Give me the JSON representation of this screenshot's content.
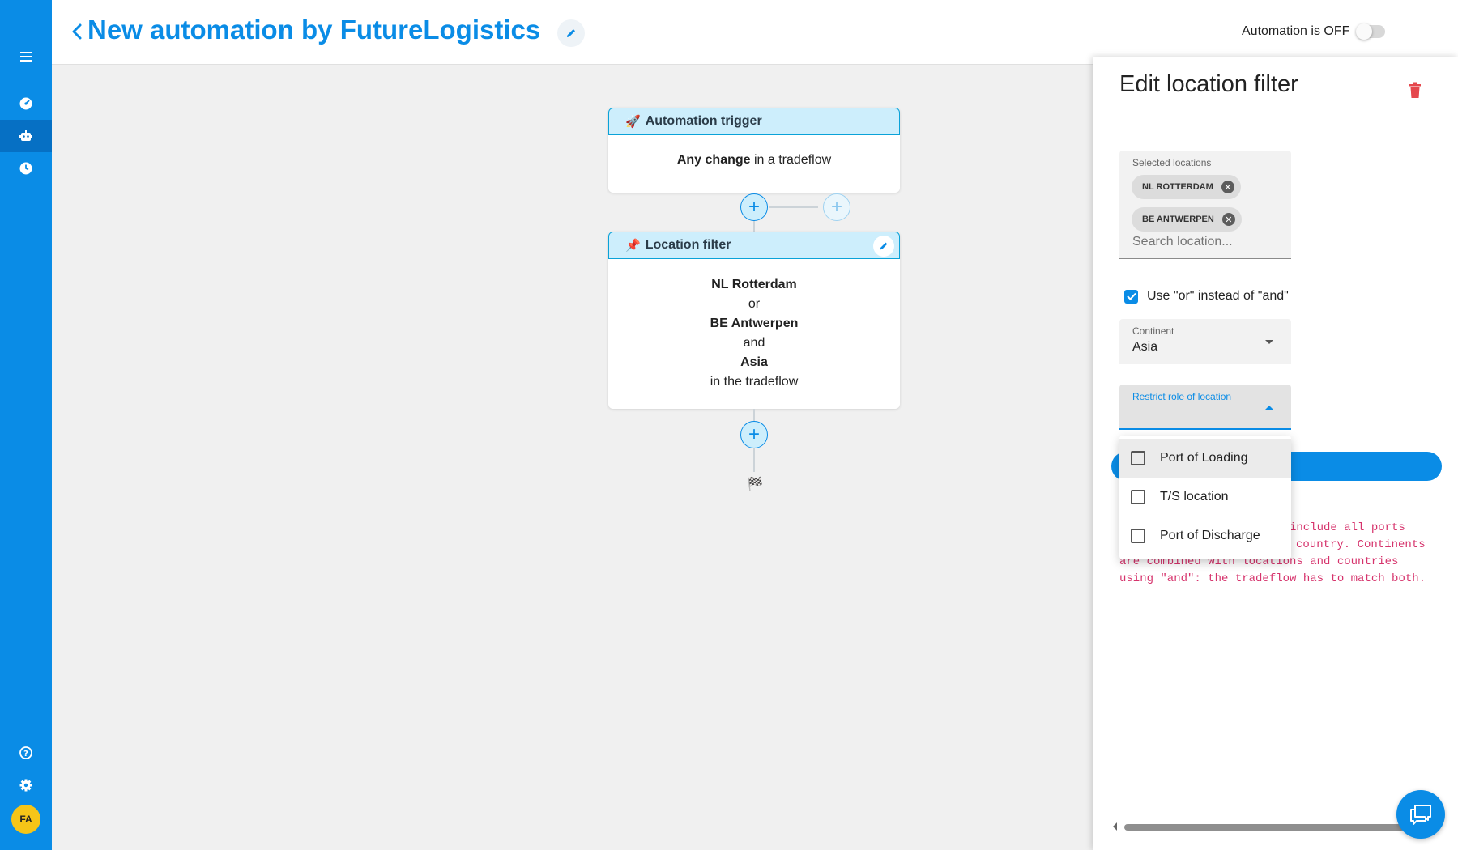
{
  "sidebar": {
    "items": [
      {
        "icon": "menu-icon"
      },
      {
        "icon": "dashboard-icon"
      },
      {
        "icon": "robot-icon",
        "active": true
      },
      {
        "icon": "clock-icon"
      },
      {
        "icon": "help-icon"
      },
      {
        "icon": "settings-icon"
      }
    ],
    "avatar_initials": "FA"
  },
  "header": {
    "title": "New automation by FutureLogistics",
    "status_text": "Automation is OFF",
    "toggle_on": false
  },
  "flow": {
    "trigger": {
      "emoji": "🚀",
      "title": "Automation trigger",
      "body_bold": "Any change",
      "body_rest": " in a tradeflow"
    },
    "filter": {
      "emoji": "📌",
      "title": "Location filter",
      "lines": [
        {
          "text": "NL Rotterdam",
          "bold": true
        },
        {
          "text": "or",
          "bold": false
        },
        {
          "text": "BE Antwerpen",
          "bold": true
        },
        {
          "text": "and",
          "bold": false
        },
        {
          "text": "Asia",
          "bold": true
        },
        {
          "text": "in the tradeflow",
          "bold": false
        }
      ]
    },
    "plus_symbol": "+",
    "end_flag": "🏁"
  },
  "panel": {
    "title": "Edit location filter",
    "selected_label": "Selected locations",
    "chips": [
      "NL ROTTERDAM",
      "BE ANTWERPEN"
    ],
    "chip_remove": "✕",
    "search_placeholder": "Search location...",
    "checkbox_label": "Use \"or\" instead of \"and\"",
    "checkbox_checked": true,
    "continent_label": "Continent",
    "continent_value": "Asia",
    "role_label": "Restrict role of location",
    "role_value": "",
    "help_line1": "include all ports",
    "help_line2": "country. Continents",
    "help_line3": "are combined with locations and countries",
    "help_line4": "using \"and\": the tradeflow has to match both."
  },
  "role_menu": {
    "options": [
      "Port of Loading",
      "T/S location",
      "Port of Discharge"
    ],
    "highlighted": 0
  },
  "colors": {
    "primary": "#0a8ce6",
    "sidebar": "#0a8ce6",
    "node_header": "#cdeefc",
    "help_text": "#d6336c",
    "delete": "#e5484d",
    "avatar": "#f5c518"
  }
}
